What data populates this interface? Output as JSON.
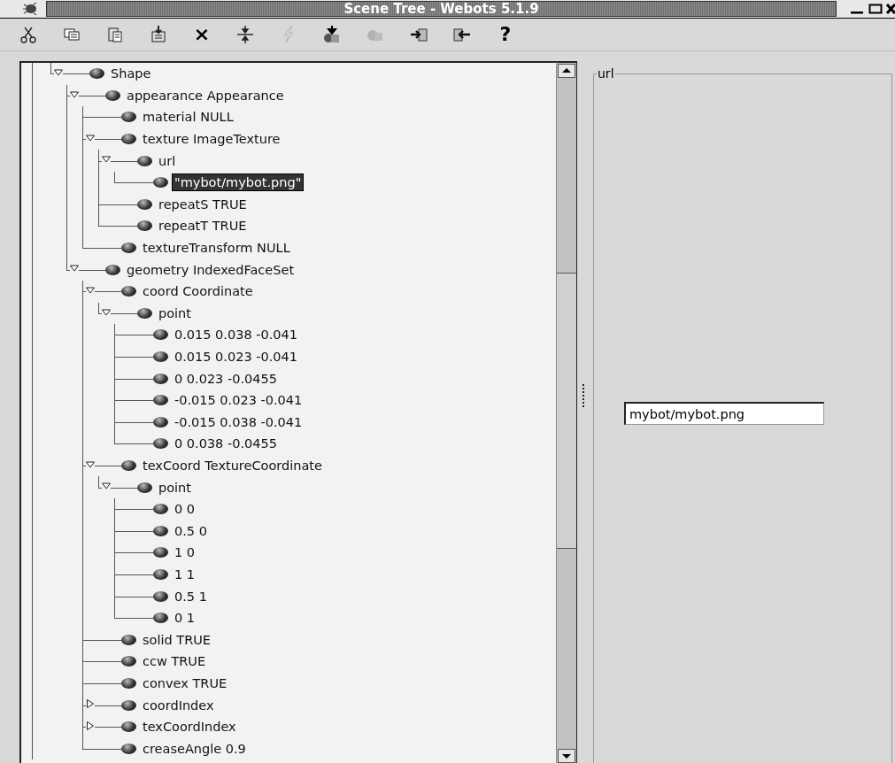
{
  "window": {
    "title": "Scene Tree - Webots 5.1.9"
  },
  "toolbar": [
    {
      "kind": "cut",
      "disabled": false
    },
    {
      "kind": "copy",
      "disabled": false
    },
    {
      "kind": "paste",
      "disabled": false
    },
    {
      "kind": "insert",
      "disabled": false
    },
    {
      "kind": "delete",
      "text": "×",
      "disabled": false
    },
    {
      "kind": "collapse",
      "disabled": false
    },
    {
      "kind": "bolt",
      "disabled": true
    },
    {
      "kind": "import",
      "disabled": false
    },
    {
      "kind": "export",
      "disabled": true
    },
    {
      "kind": "enter",
      "disabled": false
    },
    {
      "kind": "leave",
      "disabled": false
    },
    {
      "kind": "help",
      "text": "?",
      "disabled": false
    }
  ],
  "tree": {
    "nodes": [
      {
        "text": "Shape",
        "expanded": true,
        "selected": false,
        "children": [
          {
            "text": "appearance Appearance",
            "expanded": true,
            "selected": false,
            "children": [
              {
                "text": "material NULL",
                "selected": false
              },
              {
                "text": "texture ImageTexture",
                "expanded": true,
                "selected": false,
                "children": [
                  {
                    "text": "url",
                    "expanded": true,
                    "selected": false,
                    "children": [
                      {
                        "text": "\"mybot/mybot.png\"",
                        "selected": true
                      }
                    ]
                  },
                  {
                    "text": "repeatS TRUE",
                    "selected": false
                  },
                  {
                    "text": "repeatT TRUE",
                    "selected": false
                  }
                ]
              },
              {
                "text": "textureTransform NULL",
                "selected": false
              }
            ]
          },
          {
            "text": "geometry IndexedFaceSet",
            "expanded": true,
            "selected": false,
            "children": [
              {
                "text": "coord Coordinate",
                "expanded": true,
                "selected": false,
                "children": [
                  {
                    "text": "point",
                    "expanded": true,
                    "selected": false,
                    "children": [
                      {
                        "text": "0.015 0.038 -0.041",
                        "selected": false
                      },
                      {
                        "text": "0.015 0.023 -0.041",
                        "selected": false
                      },
                      {
                        "text": "0 0.023 -0.0455",
                        "selected": false
                      },
                      {
                        "text": "-0.015 0.023 -0.041",
                        "selected": false
                      },
                      {
                        "text": "-0.015 0.038 -0.041",
                        "selected": false
                      },
                      {
                        "text": "0 0.038 -0.0455",
                        "selected": false
                      }
                    ]
                  }
                ]
              },
              {
                "text": "texCoord TextureCoordinate",
                "expanded": true,
                "selected": false,
                "children": [
                  {
                    "text": "point",
                    "expanded": true,
                    "selected": false,
                    "children": [
                      {
                        "text": "0 0",
                        "selected": false
                      },
                      {
                        "text": "0.5 0",
                        "selected": false
                      },
                      {
                        "text": "1 0",
                        "selected": false
                      },
                      {
                        "text": "1 1",
                        "selected": false
                      },
                      {
                        "text": "0.5 1",
                        "selected": false
                      },
                      {
                        "text": "0 1",
                        "selected": false
                      }
                    ]
                  }
                ]
              },
              {
                "text": "solid TRUE",
                "selected": false
              },
              {
                "text": "ccw TRUE",
                "selected": false
              },
              {
                "text": "convex TRUE",
                "selected": false
              },
              {
                "text": "coordIndex",
                "expanded": false,
                "selected": false
              },
              {
                "text": "texCoordIndex",
                "expanded": false,
                "selected": false
              },
              {
                "text": "creaseAngle 0.9",
                "selected": false
              }
            ]
          }
        ]
      }
    ]
  },
  "editor": {
    "group_title": "url",
    "value": "mybot/mybot.png"
  }
}
